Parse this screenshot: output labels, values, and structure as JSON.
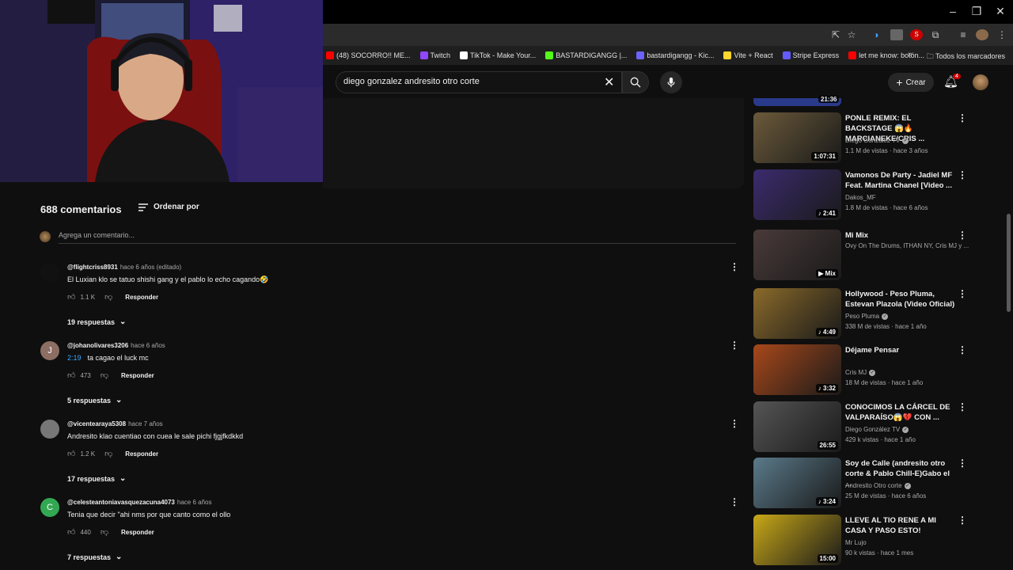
{
  "browser": {
    "bookmarks": [
      {
        "label": "(48) SOCORRO!! ME...",
        "color": "#ff0000"
      },
      {
        "label": "Twitch",
        "color": "#9146ff"
      },
      {
        "label": "TikTok - Make Your...",
        "color": "#ffffff"
      },
      {
        "label": "BASTARDIGANGG |...",
        "color": "#53fc18"
      },
      {
        "label": "bastardigangg - Kic...",
        "color": "#6c63ff"
      },
      {
        "label": "Vite + React",
        "color": "#ffd62e"
      },
      {
        "label": "Stripe Express",
        "color": "#635bff"
      },
      {
        "label": "let me know: botón...",
        "color": "#ff0000"
      }
    ],
    "all_bookmarks": "Todos los marcadores"
  },
  "header": {
    "search_query": "diego gonzalez andresito otro corte",
    "create_label": "Crear",
    "notification_count": "4"
  },
  "comments": {
    "count_label": "688 comentarios",
    "sort_label": "Ordenar por",
    "add_placeholder": "Agrega un comentario...",
    "reply_label": "Responder",
    "items": [
      {
        "user": "@flightcriss8931",
        "time": "hace 6 años (editado)",
        "timestamp": "",
        "text": "El Luxian klo se tatuo shishi gang y el pablo lo echo cagando🤣",
        "likes": "1.1 K",
        "replies": "19 respuestas",
        "avatar_letter": "",
        "avatar_color": "#111111"
      },
      {
        "user": "@johanolivares3206",
        "time": "hace 6 años",
        "timestamp": "2:19",
        "text": "ta cagao el luck mc",
        "likes": "473",
        "replies": "5 respuestas",
        "avatar_letter": "J",
        "avatar_color": "#8d6e63"
      },
      {
        "user": "@vicentearaya5308",
        "time": "hace 7 años",
        "timestamp": "",
        "text": "Andresito klao cuentiao con cuea le sale pichi fjgjfkdkkd",
        "likes": "1.2 K",
        "replies": "17 respuestas",
        "avatar_letter": "",
        "avatar_color": "#777777"
      },
      {
        "user": "@celesteantoniavasquezacuna4073",
        "time": "hace 6 años",
        "timestamp": "",
        "text": "Tenia que decir \"ahi nms por que canto como el ollo",
        "likes": "440",
        "replies": "7 respuestas",
        "avatar_letter": "C",
        "avatar_color": "#33a852"
      }
    ]
  },
  "sidebar": {
    "top_partial_duration": "21:36",
    "videos": [
      {
        "title": "PONLE REMIX: EL BACKSTAGE 😱🔥 MARCIANEKE/CRIS ...",
        "channel": "Diego González TV",
        "verified": true,
        "meta": "1.1 M de vistas · hace 3 años",
        "duration": "1:07:31",
        "thumb": "#6b5a3a"
      },
      {
        "title": "Vamonos De Party - Jadiel MF Feat. Martina Chanel [Video ...",
        "channel": "Dakos_MF",
        "verified": false,
        "meta": "1.8 M de vistas · hace 6 años",
        "duration": "♪ 2:41",
        "thumb": "#3b2b6e"
      },
      {
        "title": "Mi Mix",
        "channel": "Ovy On The Drums, ITHAN NY, Cris MJ y ...",
        "verified": false,
        "meta": "",
        "duration": "▶ Mix",
        "thumb": "#4a3a3a"
      },
      {
        "title": "Hollywood - Peso Pluma, Estevan Plazola (Video Oficial)",
        "channel": "Peso Pluma",
        "verified": true,
        "meta": "338 M de vistas · hace 1 año",
        "duration": "♪ 4:49",
        "thumb": "#8a6a2a"
      },
      {
        "title": "Déjame Pensar",
        "channel": "Cris MJ",
        "verified": true,
        "meta": "18 M de vistas · hace 1 año",
        "duration": "♪ 3:32",
        "thumb": "#a8481a"
      },
      {
        "title": "CONOCIMOS LA CÁRCEL DE VALPARAÍSO😱💔 CON ...",
        "channel": "Diego González TV",
        "verified": true,
        "meta": "429 k vistas · hace 1 año",
        "duration": "26:55",
        "thumb": "#555555"
      },
      {
        "title": "Soy de Calle (andresito otro corte & Pablo Chill-E)Gabo el ...",
        "channel": "Andresito Otro corte",
        "verified": true,
        "meta": "25 M de vistas · hace 6 años",
        "duration": "♪ 3:24",
        "thumb": "#5a7a8a"
      },
      {
        "title": "LLEVE AL TIO RENE A MI CASA Y PASO ESTO!",
        "channel": "Mr Lujo",
        "verified": false,
        "meta": "90 k vistas · hace 1 mes",
        "duration": "15:00",
        "thumb": "#c8a818"
      }
    ]
  }
}
